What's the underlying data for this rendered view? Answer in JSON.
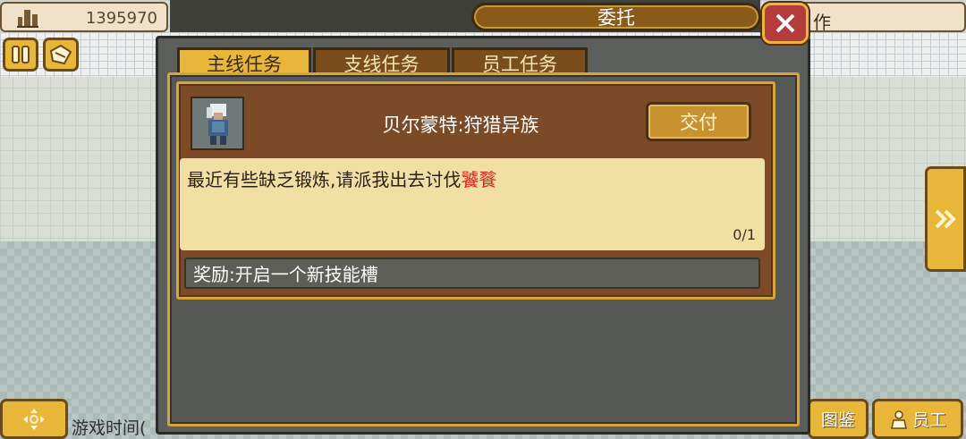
{
  "hud": {
    "money": "1395970",
    "right_tab_label": "作"
  },
  "dialog": {
    "title": "委托",
    "tabs": [
      {
        "label": "主线任务",
        "active": true
      },
      {
        "label": "支线任务",
        "active": false
      },
      {
        "label": "员工任务",
        "active": false
      }
    ],
    "quest": {
      "name": "贝尔蒙特:狩猎异族",
      "deliver_label": "交付",
      "description": "最近有些缺乏锻炼,请派我出去讨伐",
      "target": "饕餮",
      "progress": "0/1",
      "reward": "奖励:开启一个新技能槽"
    }
  },
  "bottom": {
    "game_time_label": "游戏时间(",
    "atlas_label": "图鉴",
    "staff_label": "员工"
  },
  "colors": {
    "accent_gold": "#e8b73a",
    "card_brown": "#7d4a27",
    "target_red": "#e02020",
    "close_red": "#b53c3c"
  }
}
